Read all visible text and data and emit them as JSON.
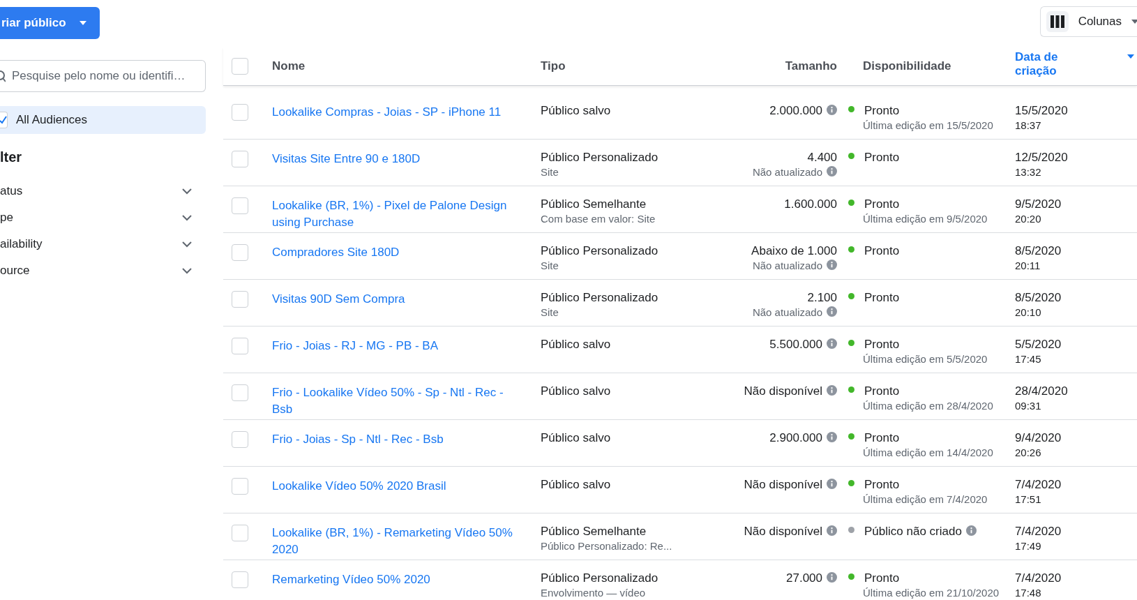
{
  "create_button": {
    "label": "riar público"
  },
  "search": {
    "placeholder": "Pesquise pelo nome ou identifi…"
  },
  "audience_filter": {
    "label": "All Audiences",
    "checked": true
  },
  "filter": {
    "title": "lter",
    "items": [
      {
        "label": "atus",
        "expanded": false
      },
      {
        "label": "pe",
        "expanded": false
      },
      {
        "label": "ailability",
        "expanded": false
      },
      {
        "label": "ource",
        "expanded": false
      }
    ]
  },
  "columns_button": {
    "label": "Colunas"
  },
  "table": {
    "select_all": {
      "checked": false
    },
    "columns": [
      {
        "label": "Nome",
        "selected": false
      },
      {
        "label": "Tipo",
        "selected": false
      },
      {
        "label": "Tamanho",
        "selected": false
      },
      {
        "label": "Disponibilidade",
        "selected": false
      },
      {
        "label": "Data de criação",
        "selected": true
      }
    ],
    "rows": [
      {
        "checked": false,
        "name": "Lookalike Compras - Joias - SP - iPhone 11",
        "type": "Público salvo",
        "size": "2.000.000",
        "status": "Pronto",
        "color": "#42b72a",
        "status_info": false,
        "status_note": "Última edição em 15/5/2020",
        "date": "15/5/2020",
        "time": "18:37"
      },
      {
        "checked": false,
        "name": "Visitas Site Entre 90 e 180D",
        "type": "Público Personalizado",
        "type_note": "Site",
        "size": "4.400",
        "size_note": "Não atualizado",
        "status": "Pronto",
        "color": "#42b72a",
        "status_info": false,
        "date": "12/5/2020",
        "time": "13:32"
      },
      {
        "checked": false,
        "name": "Lookalike (BR, 1%) - Pixel de Palone Design using Purchase",
        "type": "Público Semelhante",
        "type_note": "Com base em valor: Site",
        "size": "1.600.000",
        "status": "Pronto",
        "color": "#42b72a",
        "status_info": false,
        "status_note": "Última edição em 9/5/2020",
        "date": "9/5/2020",
        "time": "20:20",
        "size_info": false
      },
      {
        "checked": false,
        "name": "Compradores Site 180D",
        "type": "Público Personalizado",
        "type_note": "Site",
        "size": "Abaixo de 1.000",
        "size_note": "Não atualizado",
        "status": "Pronto",
        "color": "#42b72a",
        "status_info": false,
        "date": "8/5/2020",
        "time": "20:11"
      },
      {
        "checked": false,
        "name": "Visitas 90D Sem Compra",
        "type": "Público Personalizado",
        "type_note": "Site",
        "size": "2.100",
        "size_note": "Não atualizado",
        "status": "Pronto",
        "color": "#42b72a",
        "status_info": false,
        "date": "8/5/2020",
        "time": "20:10"
      },
      {
        "checked": false,
        "name": "Frio - Joias - RJ - MG - PB - BA",
        "type": "Público salvo",
        "size": "5.500.000",
        "status": "Pronto",
        "color": "#42b72a",
        "status_info": false,
        "status_note": "Última edição em 5/5/2020",
        "date": "5/5/2020",
        "time": "17:45"
      },
      {
        "checked": false,
        "name": "Frio - Lookalike Vídeo 50% - Sp - Ntl - Rec - Bsb",
        "type": "Público salvo",
        "size": "Não disponível",
        "status": "Pronto",
        "color": "#42b72a",
        "status_info": false,
        "status_note": "Última edição em 28/4/2020",
        "date": "28/4/2020",
        "time": "09:31"
      },
      {
        "checked": false,
        "name": "Frio - Joias - Sp - Ntl - Rec - Bsb",
        "type": "Público salvo",
        "size": "2.900.000",
        "status": "Pronto",
        "color": "#42b72a",
        "status_info": false,
        "status_note": "Última edição em 14/4/2020",
        "date": "9/4/2020",
        "time": "20:26"
      },
      {
        "checked": false,
        "name": "Lookalike Vídeo 50% 2020 Brasil",
        "type": "Público salvo",
        "size": "Não disponível",
        "status": "Pronto",
        "color": "#42b72a",
        "status_info": false,
        "status_note": "Última edição em 7/4/2020",
        "date": "7/4/2020",
        "time": "17:51"
      },
      {
        "checked": false,
        "name": "Lookalike (BR, 1%) - Remarketing Vídeo 50% 2020",
        "type": "Público Semelhante",
        "type_note": "Público Personalizado: Re...",
        "size": "Não disponível",
        "status": "Público não criado",
        "color": "#9ea2a8",
        "status_info": true,
        "date": "7/4/2020",
        "time": "17:49"
      },
      {
        "checked": false,
        "name": "Remarketing Vídeo 50% 2020",
        "type": "Público Personalizado",
        "type_note": "Envolvimento — vídeo",
        "size": "27.000",
        "status": "Pronto",
        "color": "#42b72a",
        "status_info": false,
        "status_note": "Última edição em 21/10/2020",
        "date": "7/4/2020",
        "time": "17:48"
      }
    ]
  }
}
